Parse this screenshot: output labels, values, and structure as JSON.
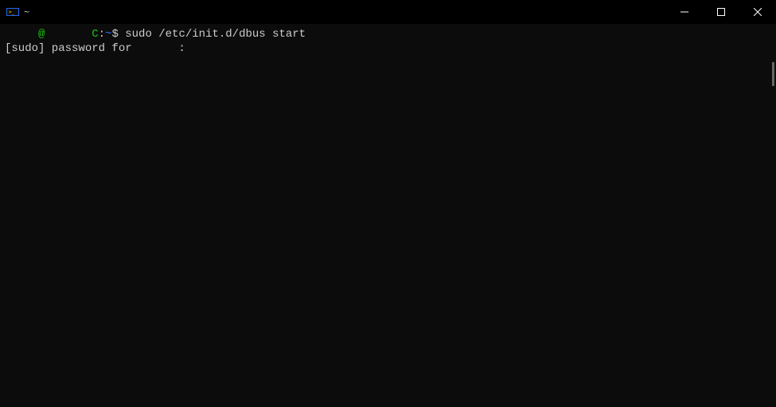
{
  "titlebar": {
    "title": "~"
  },
  "terminal": {
    "prompt": {
      "user_host": "     @       C",
      "separator1": ":",
      "path": "~",
      "dollar": "$"
    },
    "command": "sudo /etc/init.d/dbus start",
    "output_line": "[sudo] password for       :"
  }
}
